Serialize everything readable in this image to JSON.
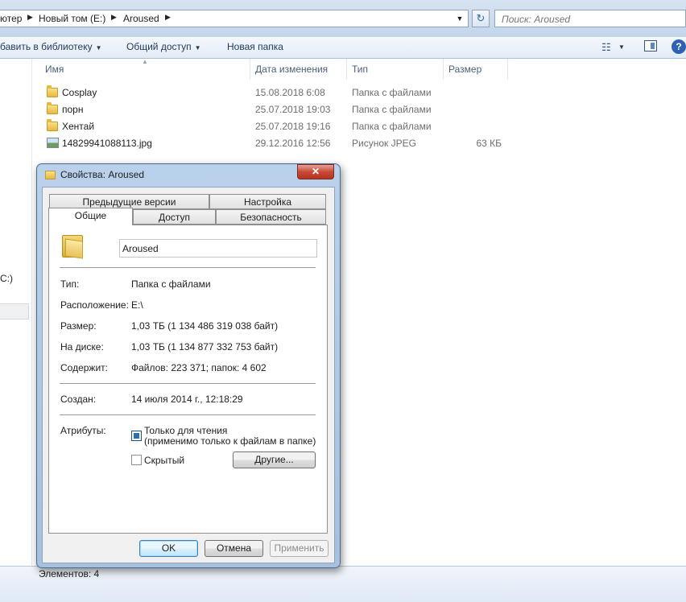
{
  "address_bar": {
    "crumbs": [
      "ютер",
      "Новый том (E:)",
      "Aroused"
    ],
    "search_placeholder": "Поиск: Aroused"
  },
  "toolbar": {
    "library_label": "бавить в библиотеку",
    "share_label": "Общий доступ",
    "new_folder_label": "Новая папка"
  },
  "nav": {
    "drive_label": "C:)"
  },
  "columns": {
    "name": "Имя",
    "date": "Дата изменения",
    "type": "Тип",
    "size": "Размер"
  },
  "files": [
    {
      "name": "Cosplay",
      "date": "15.08.2018 6:08",
      "type": "Папка с файлами",
      "size": "",
      "icon": "folder-icon"
    },
    {
      "name": "порн",
      "date": "25.07.2018 19:03",
      "type": "Папка с файлами",
      "size": "",
      "icon": "folder-icon"
    },
    {
      "name": "Хентай",
      "date": "25.07.2018 19:16",
      "type": "Папка с файлами",
      "size": "",
      "icon": "folder-icon"
    },
    {
      "name": "14829941088113.jpg",
      "date": "29.12.2016 12:56",
      "type": "Рисунок JPEG",
      "size": "63 КБ",
      "icon": "image-file-icon"
    }
  ],
  "status": {
    "count": "Элементов: 4"
  },
  "dialog": {
    "title": "Свойства: Aroused",
    "close_glyph": "✕",
    "tabs_back": [
      "Предыдущие версии",
      "Настройка"
    ],
    "tabs_front": [
      "Общие",
      "Доступ",
      "Безопасность"
    ],
    "folder_name": "Aroused",
    "props": {
      "type_label": "Тип:",
      "type_value": "Папка с файлами",
      "location_label": "Расположение:",
      "location_value": "E:\\",
      "size_label": "Размер:",
      "size_value": "1,03 ТБ (1 134 486 319 038 байт)",
      "disk_label": "На диске:",
      "disk_value": "1,03 ТБ (1 134 877 332 753 байт)",
      "contains_label": "Содержит:",
      "contains_value": "Файлов: 223 371; папок: 4 602",
      "created_label": "Создан:",
      "created_value": "14 июля 2014 г., 12:18:29",
      "attributes_label": "Атрибуты:"
    },
    "attributes": {
      "readonly_line1": "Только для чтения",
      "readonly_line2": "(применимо только к файлам в папке)",
      "hidden": "Скрытый",
      "other_button": "Другие..."
    },
    "buttons": {
      "ok": "OK",
      "cancel": "Отмена",
      "apply": "Применить"
    }
  }
}
